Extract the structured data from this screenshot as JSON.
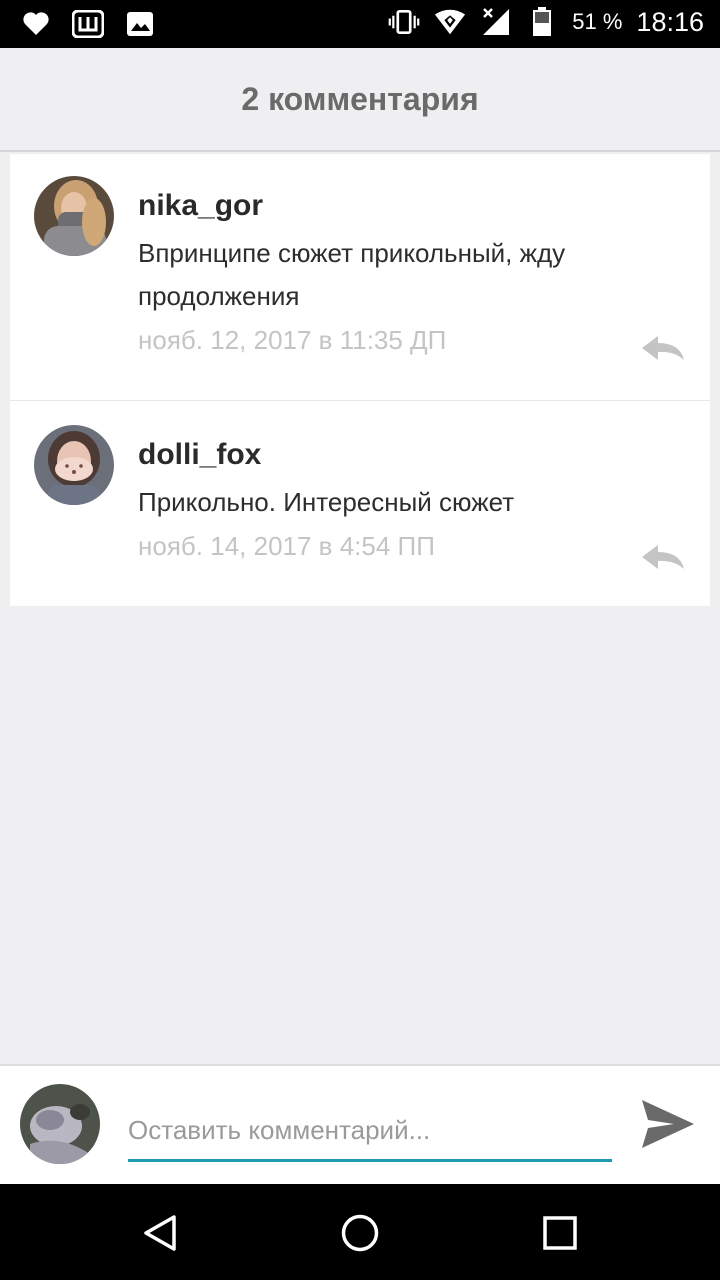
{
  "status_bar": {
    "left_icons": [
      "heart-icon",
      "wattpad-icon",
      "image-icon"
    ],
    "right_icons": [
      "vibrate-icon",
      "wifi-icon",
      "signal-icon",
      "battery-icon"
    ],
    "battery": "51 %",
    "time": "18:16"
  },
  "header": {
    "title": "2 комментария"
  },
  "comments": [
    {
      "username": "nika_gor",
      "text": "Впринципе сюжет прикольный, жду продолжения",
      "date": "нояб. 12, 2017 в 11:35 ДП"
    },
    {
      "username": "dolli_fox",
      "text": "Прикольно. Интересный сюжет",
      "date": "нояб. 14, 2017 в 4:54 ПП"
    }
  ],
  "composer": {
    "placeholder": "Оставить комментарий..."
  },
  "colors": {
    "accent": "#1e9bb1",
    "background": "#efeef0",
    "date_text": "#c4c4c4"
  },
  "nav_bar": {
    "buttons": [
      "back-icon",
      "home-icon",
      "recents-icon"
    ]
  }
}
